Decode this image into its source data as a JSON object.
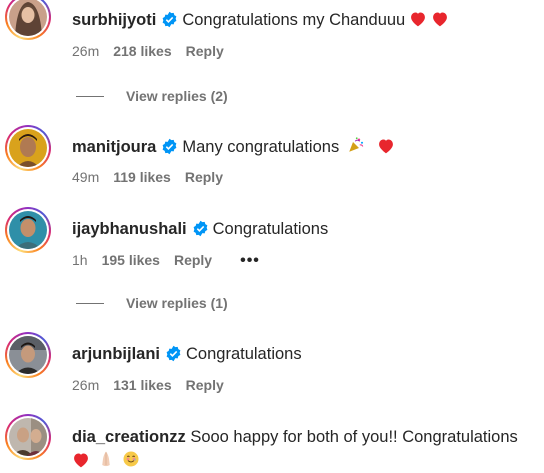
{
  "colors": {
    "verified": "#0095f6",
    "meta": "#737373",
    "text": "#262626"
  },
  "comments": [
    {
      "username": "surbhijyoti",
      "text": "Congratulations my Chanduuu",
      "emojis": [
        "red-heart",
        "red-heart"
      ],
      "time": "26m",
      "likes": "218 likes",
      "reply": "Reply",
      "view_replies": "View replies (2)"
    },
    {
      "username": "manitjoura",
      "text": "Many congratulations",
      "emojis": [
        "party-popper",
        "red-heart"
      ],
      "time": "49m",
      "likes": "119 likes",
      "reply": "Reply"
    },
    {
      "username": "ijaybhanushali",
      "text": "Congratulations",
      "time": "1h",
      "likes": "195 likes",
      "reply": "Reply",
      "more": "•••",
      "view_replies": "View replies (1)"
    },
    {
      "username": "arjunbijlani",
      "text": "Congratulations",
      "time": "26m",
      "likes": "131 likes",
      "reply": "Reply"
    },
    {
      "username": "dia_creationzz",
      "text": "Sooo happy for both of you!! Congratulations",
      "emojis": [
        "red-heart",
        "folded-hands",
        "smiling-face-with-tear"
      ]
    }
  ]
}
